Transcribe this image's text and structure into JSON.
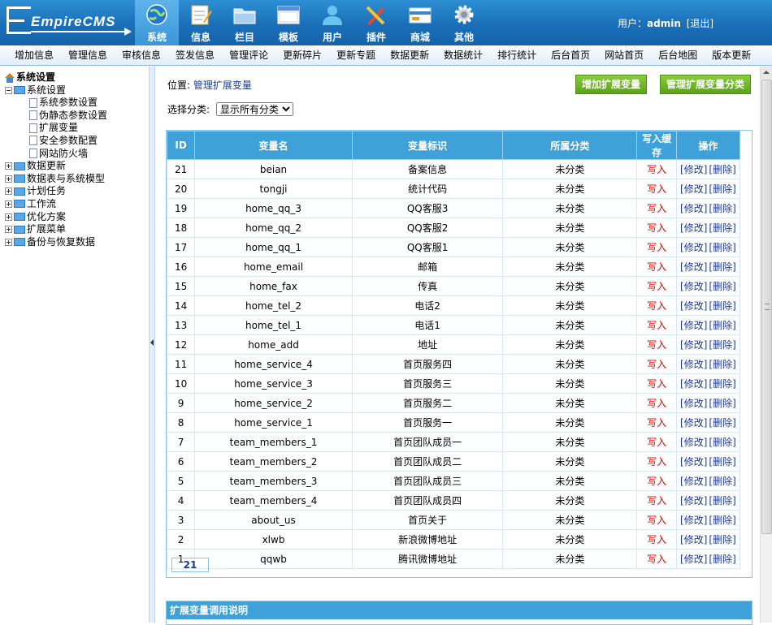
{
  "header": {
    "logo_text": "EmpireCMS",
    "nav": [
      {
        "label": "系统",
        "icon": "globe-icon",
        "active": true
      },
      {
        "label": "信息",
        "icon": "notepad-icon",
        "active": false
      },
      {
        "label": "栏目",
        "icon": "folder-icon",
        "active": false
      },
      {
        "label": "模板",
        "icon": "window-icon",
        "active": false
      },
      {
        "label": "用户",
        "icon": "user-icon",
        "active": false
      },
      {
        "label": "插件",
        "icon": "tools-icon",
        "active": false
      },
      {
        "label": "商城",
        "icon": "card-icon",
        "active": false
      },
      {
        "label": "其他",
        "icon": "gear-icon",
        "active": false
      }
    ],
    "user_label": "用户：",
    "user_name": "admin",
    "logout": "[退出]"
  },
  "subnav": [
    "增加信息",
    "管理信息",
    "审核信息",
    "签发信息",
    "管理评论",
    "更新碎片",
    "更新专题",
    "数据更新",
    "数据统计",
    "排行统计",
    "后台首页",
    "网站首页",
    "后台地图",
    "版本更新"
  ],
  "sidebar": {
    "root": "系统设置",
    "open_folder": "系统设置",
    "children": [
      "系统参数设置",
      "伪静态参数设置",
      "扩展变量",
      "安全参数配置",
      "网站防火墙"
    ],
    "folders": [
      "数据更新",
      "数据表与系统模型",
      "计划任务",
      "工作流",
      "优化方案",
      "扩展菜单",
      "备份与恢复数据"
    ]
  },
  "main": {
    "location_label": "位置:",
    "location_link": "管理扩展变量",
    "add_button": "增加扩展变量",
    "manage_button": "管理扩展变量分类",
    "filter_label": "选择分类:",
    "filter_value": "显示所有分类",
    "columns": [
      "ID",
      "变量名",
      "变量标识",
      "所属分类",
      "写入缓存",
      "操作"
    ],
    "rows": [
      {
        "id": "21",
        "name": "beian",
        "label": "备案信息",
        "cat": "未分类",
        "cache": "写入"
      },
      {
        "id": "20",
        "name": "tongji",
        "label": "统计代码",
        "cat": "未分类",
        "cache": "写入"
      },
      {
        "id": "19",
        "name": "home_qq_3",
        "label": "QQ客服3",
        "cat": "未分类",
        "cache": "写入"
      },
      {
        "id": "18",
        "name": "home_qq_2",
        "label": "QQ客服2",
        "cat": "未分类",
        "cache": "写入"
      },
      {
        "id": "17",
        "name": "home_qq_1",
        "label": "QQ客服1",
        "cat": "未分类",
        "cache": "写入"
      },
      {
        "id": "16",
        "name": "home_email",
        "label": "邮箱",
        "cat": "未分类",
        "cache": "写入"
      },
      {
        "id": "15",
        "name": "home_fax",
        "label": "传真",
        "cat": "未分类",
        "cache": "写入"
      },
      {
        "id": "14",
        "name": "home_tel_2",
        "label": "电话2",
        "cat": "未分类",
        "cache": "写入"
      },
      {
        "id": "13",
        "name": "home_tel_1",
        "label": "电话1",
        "cat": "未分类",
        "cache": "写入"
      },
      {
        "id": "12",
        "name": "home_add",
        "label": "地址",
        "cat": "未分类",
        "cache": "写入"
      },
      {
        "id": "11",
        "name": "home_service_4",
        "label": "首页服务四",
        "cat": "未分类",
        "cache": "写入"
      },
      {
        "id": "10",
        "name": "home_service_3",
        "label": "首页服务三",
        "cat": "未分类",
        "cache": "写入"
      },
      {
        "id": "9",
        "name": "home_service_2",
        "label": "首页服务二",
        "cat": "未分类",
        "cache": "写入"
      },
      {
        "id": "8",
        "name": "home_service_1",
        "label": "首页服务一",
        "cat": "未分类",
        "cache": "写入"
      },
      {
        "id": "7",
        "name": "team_members_1",
        "label": "首页团队成员一",
        "cat": "未分类",
        "cache": "写入"
      },
      {
        "id": "6",
        "name": "team_members_2",
        "label": "首页团队成员二",
        "cat": "未分类",
        "cache": "写入"
      },
      {
        "id": "5",
        "name": "team_members_3",
        "label": "首页团队成员三",
        "cat": "未分类",
        "cache": "写入"
      },
      {
        "id": "4",
        "name": "team_members_4",
        "label": "首页团队成员四",
        "cat": "未分类",
        "cache": "写入"
      },
      {
        "id": "3",
        "name": "about_us",
        "label": "首页关于",
        "cat": "未分类",
        "cache": "写入"
      },
      {
        "id": "2",
        "name": "xlwb",
        "label": "新浪微博地址",
        "cat": "未分类",
        "cache": "写入"
      },
      {
        "id": "1",
        "name": "qqwb",
        "label": "腾讯微博地址",
        "cat": "未分类",
        "cache": "写入"
      }
    ],
    "edit_link": "[修改]",
    "delete_link": "[删除]",
    "total": "21",
    "help_title": "扩展变量调用说明"
  }
}
